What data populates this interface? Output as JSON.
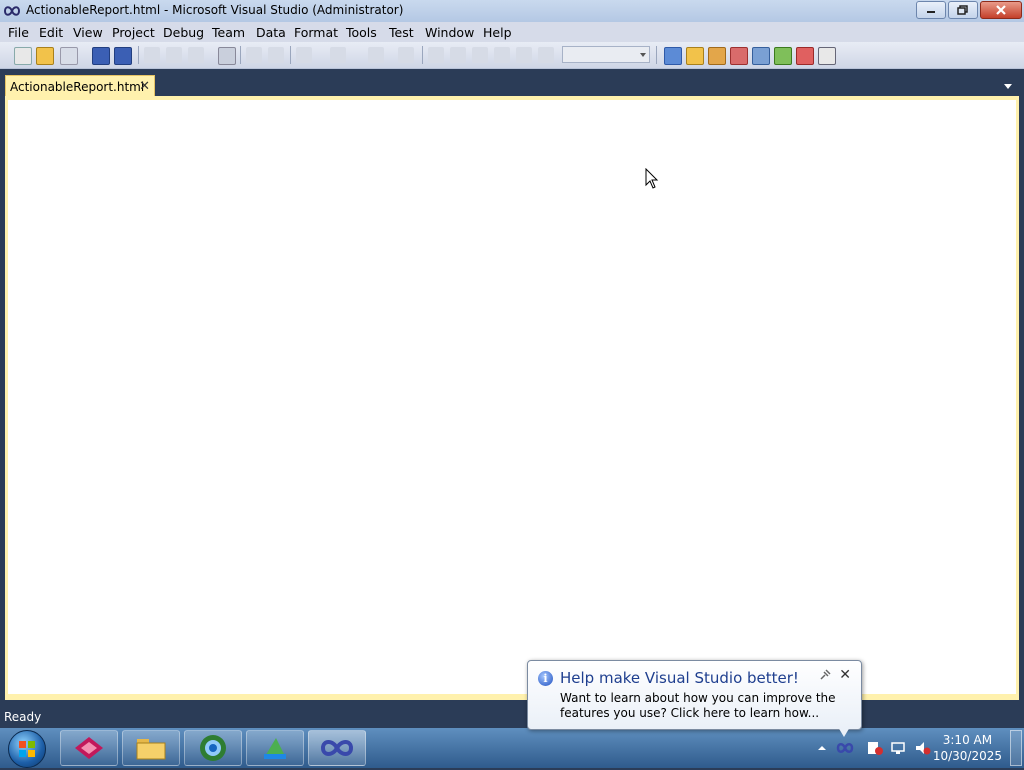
{
  "window": {
    "title": "ActionableReport.html - Microsoft Visual Studio (Administrator)"
  },
  "menu": [
    "File",
    "Edit",
    "View",
    "Project",
    "Debug",
    "Team",
    "Data",
    "Format",
    "Tools",
    "Test",
    "Window",
    "Help"
  ],
  "tabs": [
    {
      "label": "ActionableReport.html",
      "close": "✕"
    }
  ],
  "status": {
    "text": "Ready"
  },
  "notification": {
    "title": "Help make Visual Studio better!",
    "message": "Want to learn about how you can improve the features you use? Click here to learn how...",
    "info_glyph": "i",
    "close_glyph": "✕"
  },
  "clock": {
    "time": "3:10 AM",
    "date": "10/30/2025"
  },
  "taskbar_apps": [
    "visual-studio-installer",
    "file-explorer",
    "browser",
    "project-tool",
    "visual-studio"
  ],
  "colors": {
    "accent": "#fff1ad",
    "ide_bg": "#2b3c57",
    "taskbar": "#3f6fa4"
  }
}
